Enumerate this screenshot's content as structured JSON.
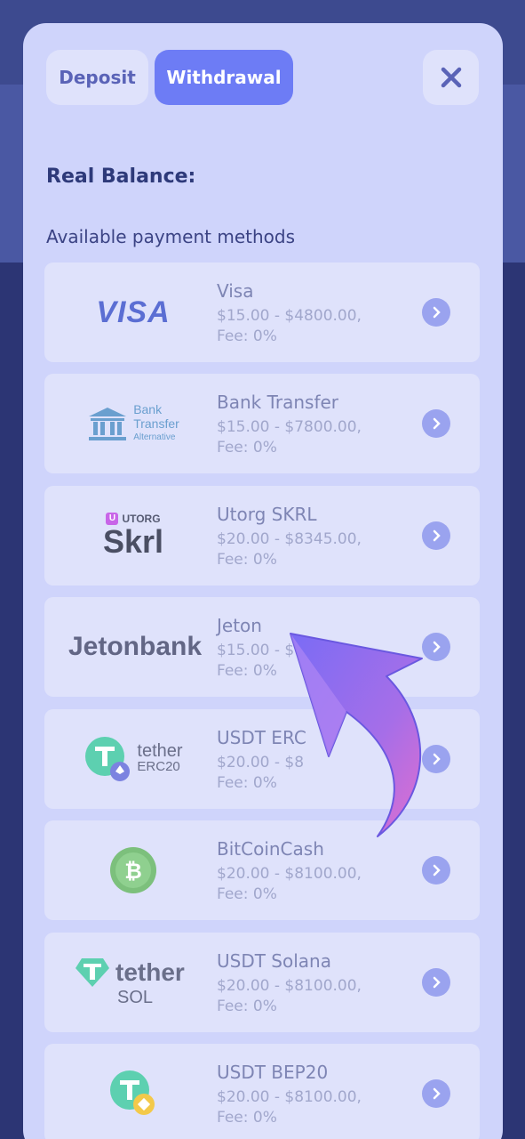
{
  "tabs": {
    "deposit": "Deposit",
    "withdrawal": "Withdrawal"
  },
  "balance_label": "Real Balance:",
  "section_title": "Available payment methods",
  "methods": [
    {
      "name": "Visa",
      "range": "$15.00 - $4800.00,",
      "fee": "Fee: 0%",
      "logo_text": "VISA",
      "logo": "visa-logo"
    },
    {
      "name": "Bank Transfer",
      "range": "$15.00 - $7800.00,",
      "fee": "Fee: 0%",
      "logo_text": "Bank",
      "logo_text2": "Transfer",
      "logo_text3": "Alternative",
      "logo": "bank-icon"
    },
    {
      "name": "Utorg SKRL",
      "range": "$20.00 - $8345.00,",
      "fee": "Fee: 0%",
      "logo_text": "UTORG",
      "logo_text2": "Skrl",
      "logo": "utorg-logo"
    },
    {
      "name": "Jeton",
      "range": "$15.00 - $",
      "fee": "Fee: 0%",
      "logo_text": "Jetonbank",
      "logo": "jetonbank-logo"
    },
    {
      "name": "USDT ERC",
      "range": "$20.00 - $8",
      "fee": "Fee: 0%",
      "logo_text": "tether",
      "logo_text2": "ERC20",
      "logo": "tether-erc20-logo"
    },
    {
      "name": "BitCoinCash",
      "range": "$20.00 - $8100.00,",
      "fee": "Fee: 0%",
      "logo": "bitcoin-cash-icon"
    },
    {
      "name": "USDT Solana",
      "range": "$20.00 - $8100.00,",
      "fee": "Fee: 0%",
      "logo_text": "tether",
      "logo_text2": "SOL",
      "logo": "tether-sol-logo"
    },
    {
      "name": "USDT BEP20",
      "range": "$20.00 - $8100.00,",
      "fee": "Fee: 0%",
      "logo": "tether-bep20-logo"
    }
  ],
  "colors": {
    "accent": "#6d7cf5",
    "panel": "#cfd4fb",
    "card": "#dfe2fb",
    "arrow": "#9b6cf0"
  },
  "icons": {
    "close": "close-icon",
    "chevron": "chevron-right-icon",
    "arrow": "arrow-pointer-graphic"
  }
}
